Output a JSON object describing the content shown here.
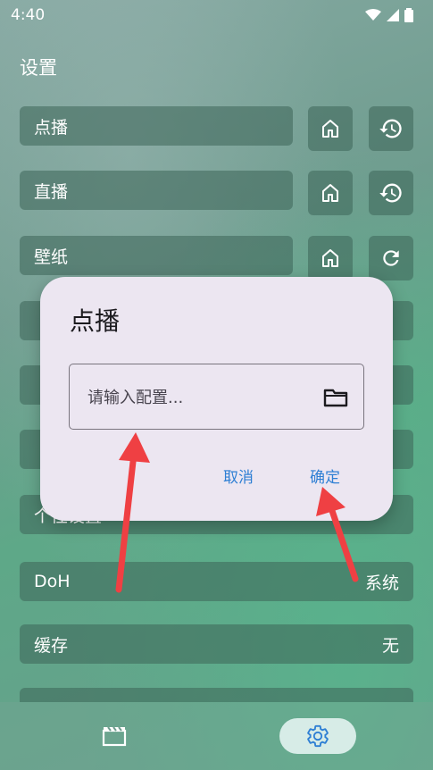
{
  "status_bar": {
    "time": "4:40"
  },
  "page": {
    "title": "设置"
  },
  "rows": [
    {
      "label": "点播"
    },
    {
      "label": "直播"
    },
    {
      "label": "壁纸"
    }
  ],
  "hidden_rows": [
    {
      "label": "个性设置",
      "value": ""
    }
  ],
  "doh": {
    "label": "DoH",
    "value": "系统"
  },
  "cache": {
    "label": "缓存",
    "value": "无"
  },
  "dialog": {
    "title": "点播",
    "input_placeholder": "请输入配置...",
    "input_value": "",
    "cancel_label": "取消",
    "confirm_label": "确定"
  },
  "bottom_nav": {
    "items": [
      {
        "icon": "movie-icon",
        "active": false
      },
      {
        "icon": "gear-icon",
        "active": true
      }
    ]
  },
  "colors": {
    "dialog_bg": "#ece6f1",
    "accent": "#2e7fd4",
    "arrow": "#ef4043",
    "nav_active": "#d7ece7"
  }
}
